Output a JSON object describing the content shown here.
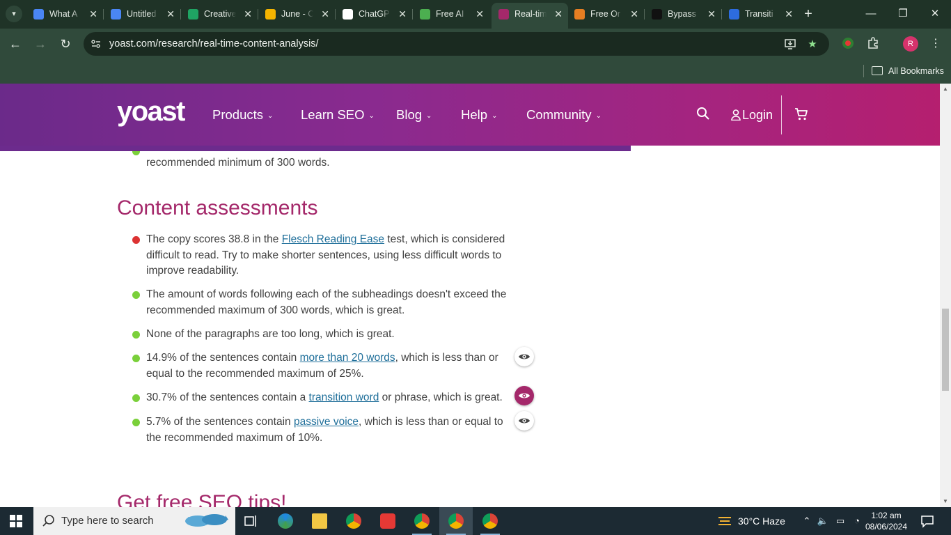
{
  "browser": {
    "tabs": [
      {
        "label": "What A",
        "favicon_color": "#4a86f5"
      },
      {
        "label": "Untitled",
        "favicon_color": "#4a86f5"
      },
      {
        "label": "Creative",
        "favicon_color": "#1fa463"
      },
      {
        "label": "June - C",
        "favicon_color": "#f4b400"
      },
      {
        "label": "ChatGP",
        "favicon_color": "#ffffff"
      },
      {
        "label": "Free AI",
        "favicon_color": "#4caf50"
      },
      {
        "label": "Real-tim",
        "favicon_color": "#a4286a",
        "active": true
      },
      {
        "label": "Free Or",
        "favicon_color": "#e67e22"
      },
      {
        "label": "Bypass",
        "favicon_color": "#111111"
      },
      {
        "label": "Transiti",
        "favicon_color": "#2d6cdf"
      }
    ],
    "close_glyph": "✕",
    "new_tab_glyph": "+",
    "url": "yoast.com/research/real-time-content-analysis/",
    "bookmarks_label": "All Bookmarks",
    "profile_initial": "R"
  },
  "site": {
    "logo": "yoast",
    "nav": [
      {
        "label": "Products"
      },
      {
        "label": "Learn SEO"
      },
      {
        "label": "Blog"
      },
      {
        "label": "Help"
      },
      {
        "label": "Community"
      }
    ],
    "chevron_glyph": "⌄",
    "login_label": "Login",
    "brand_color": "#a4286a"
  },
  "content": {
    "previous_item_tail": "recommended minimum of 300 words.",
    "section_title": "Content assessments",
    "assessments": [
      {
        "status": "red",
        "before": "The copy scores 38.8 in the ",
        "link": "Flesch Reading Ease",
        "after": " test, which is considered difficult to read. Try to make shorter sentences, using less difficult words to improve readability.",
        "eye": "none"
      },
      {
        "status": "green",
        "before": "The amount of words following each of the subheadings doesn't exceed the recommended maximum of 300 words, which is great.",
        "link": "",
        "after": "",
        "eye": "none"
      },
      {
        "status": "green",
        "before": "None of the paragraphs are too long, which is great.",
        "link": "",
        "after": "",
        "eye": "none"
      },
      {
        "status": "green",
        "before": "14.9% of the sentences contain ",
        "link": "more than 20 words",
        "after": ", which is less than or equal to the recommended maximum of 25%.",
        "eye": "inactive"
      },
      {
        "status": "green",
        "before": "30.7% of the sentences contain a ",
        "link": "transition word",
        "after": " or phrase, which is great.",
        "eye": "active"
      },
      {
        "status": "green",
        "before": "5.7% of the sentences contain ",
        "link": "passive voice",
        "after": ", which is less than or equal to the recommended maximum of 10%.",
        "eye": "inactive"
      }
    ],
    "next_section_title": "Get free SEO tips!"
  },
  "taskbar": {
    "search_placeholder": "Type here to search",
    "weather": "30°C  Haze",
    "time": "1:02 am",
    "date": "08/06/2024"
  }
}
